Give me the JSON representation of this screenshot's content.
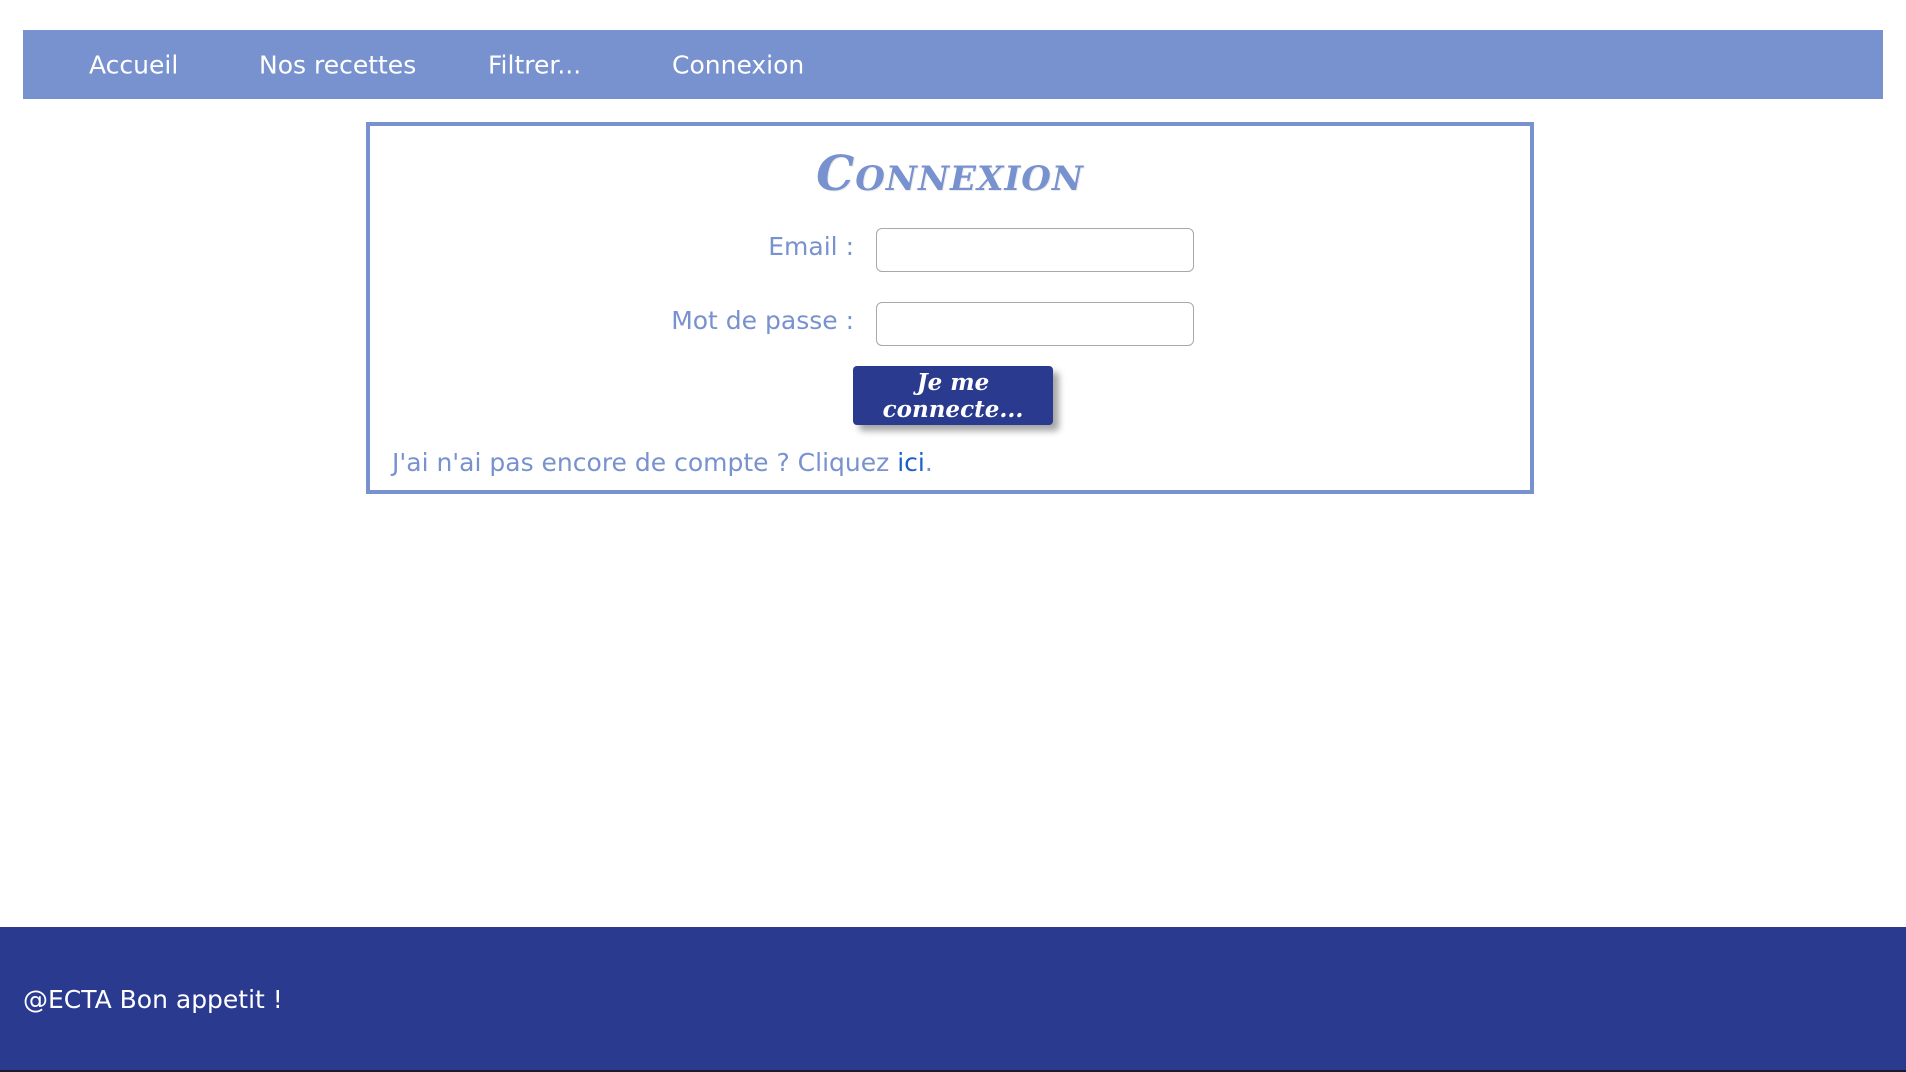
{
  "nav": {
    "items": [
      {
        "label": "Accueil"
      },
      {
        "label": "Nos recettes"
      },
      {
        "label": "Filtrer..."
      },
      {
        "label": "Connexion"
      }
    ]
  },
  "login": {
    "title": "Connexion",
    "email_label": "Email :",
    "email_value": "",
    "password_label": "Mot de passe :",
    "password_value": "",
    "submit_label": "Je me connecte...",
    "signup_prefix": "J'ai n'ai pas encore de compte ? Cliquez ",
    "signup_link": "ici",
    "signup_suffix": "."
  },
  "footer": {
    "text": "@ECTA Bon appetit !"
  },
  "colors": {
    "nav_bg": "#7891cf",
    "accent": "#7891cf",
    "button_bg": "#2a3a8f",
    "footer_bg": "#2a3a8f",
    "link": "#1a5fc8"
  }
}
